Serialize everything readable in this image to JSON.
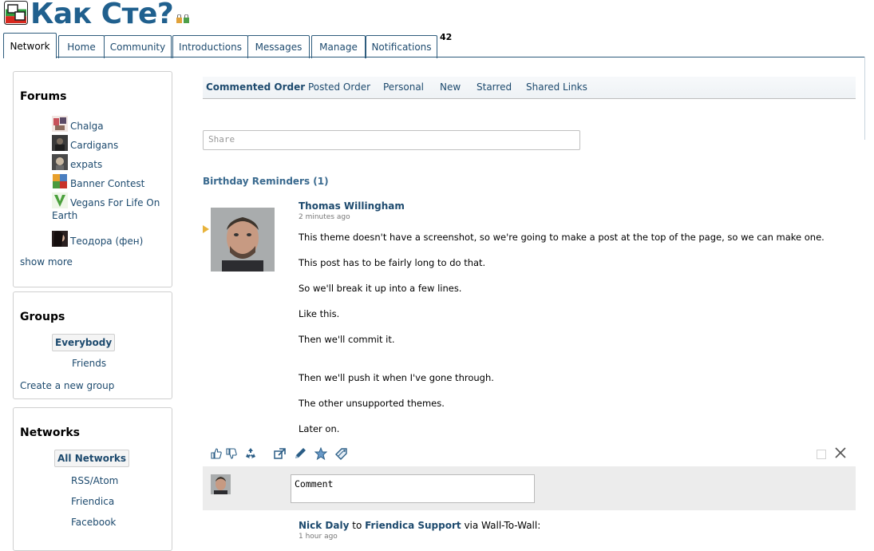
{
  "site": {
    "name": "Как Сте?"
  },
  "tabs": [
    {
      "label": "Network",
      "active": true
    },
    {
      "label": "Home"
    },
    {
      "label": "Community"
    },
    {
      "label": "Introductions"
    },
    {
      "label": "Messages"
    },
    {
      "label": "Manage"
    },
    {
      "label": "Notifications"
    }
  ],
  "notifications_count": "42",
  "sidebar": {
    "forums": {
      "title": "Forums",
      "items": [
        {
          "name": "Chalga"
        },
        {
          "name": "Cardigans"
        },
        {
          "name": "expats"
        },
        {
          "name": "Banner Contest"
        },
        {
          "name": "Vegans For Life On Earth"
        },
        {
          "name": "Теодора (фен)"
        }
      ],
      "show_more": "show more"
    },
    "groups": {
      "title": "Groups",
      "everybody": "Everybody",
      "friends": "Friends",
      "create": "Create a new group"
    },
    "networks": {
      "title": "Networks",
      "all": "All Networks",
      "items": [
        "RSS/Atom",
        "Friendica",
        "Facebook"
      ]
    }
  },
  "subtabs": [
    {
      "label": "Commented Order",
      "active": true
    },
    {
      "label": "Posted Order"
    },
    {
      "label": "Personal"
    },
    {
      "label": "New"
    },
    {
      "label": "Starred"
    },
    {
      "label": "Shared Links"
    }
  ],
  "share": {
    "placeholder": "Share"
  },
  "birthday": "Birthday Reminders (1)",
  "post": {
    "author": "Thomas Willingham",
    "time": "2 minutes ago",
    "lines": [
      "This theme doesn't have a screenshot, so we're going to make a post at the top of the page, so we can make one.",
      "This post has to be fairly long to do that.",
      "So we'll break it up into a few lines.",
      "Like this.",
      "Then we'll commit it.",
      "Then we'll push it when I've gone through.",
      "The other unsupported themes.",
      "Later on."
    ]
  },
  "comment": {
    "placeholder": "Comment"
  },
  "post2": {
    "author": "Nick Daly",
    "to": "to",
    "target": "Friendica Support",
    "via": "via Wall-To-Wall:",
    "time": "1 hour ago"
  },
  "colors": {
    "link": "#1d4a6e",
    "brand": "#20608e",
    "border": "#2e5c7d"
  }
}
